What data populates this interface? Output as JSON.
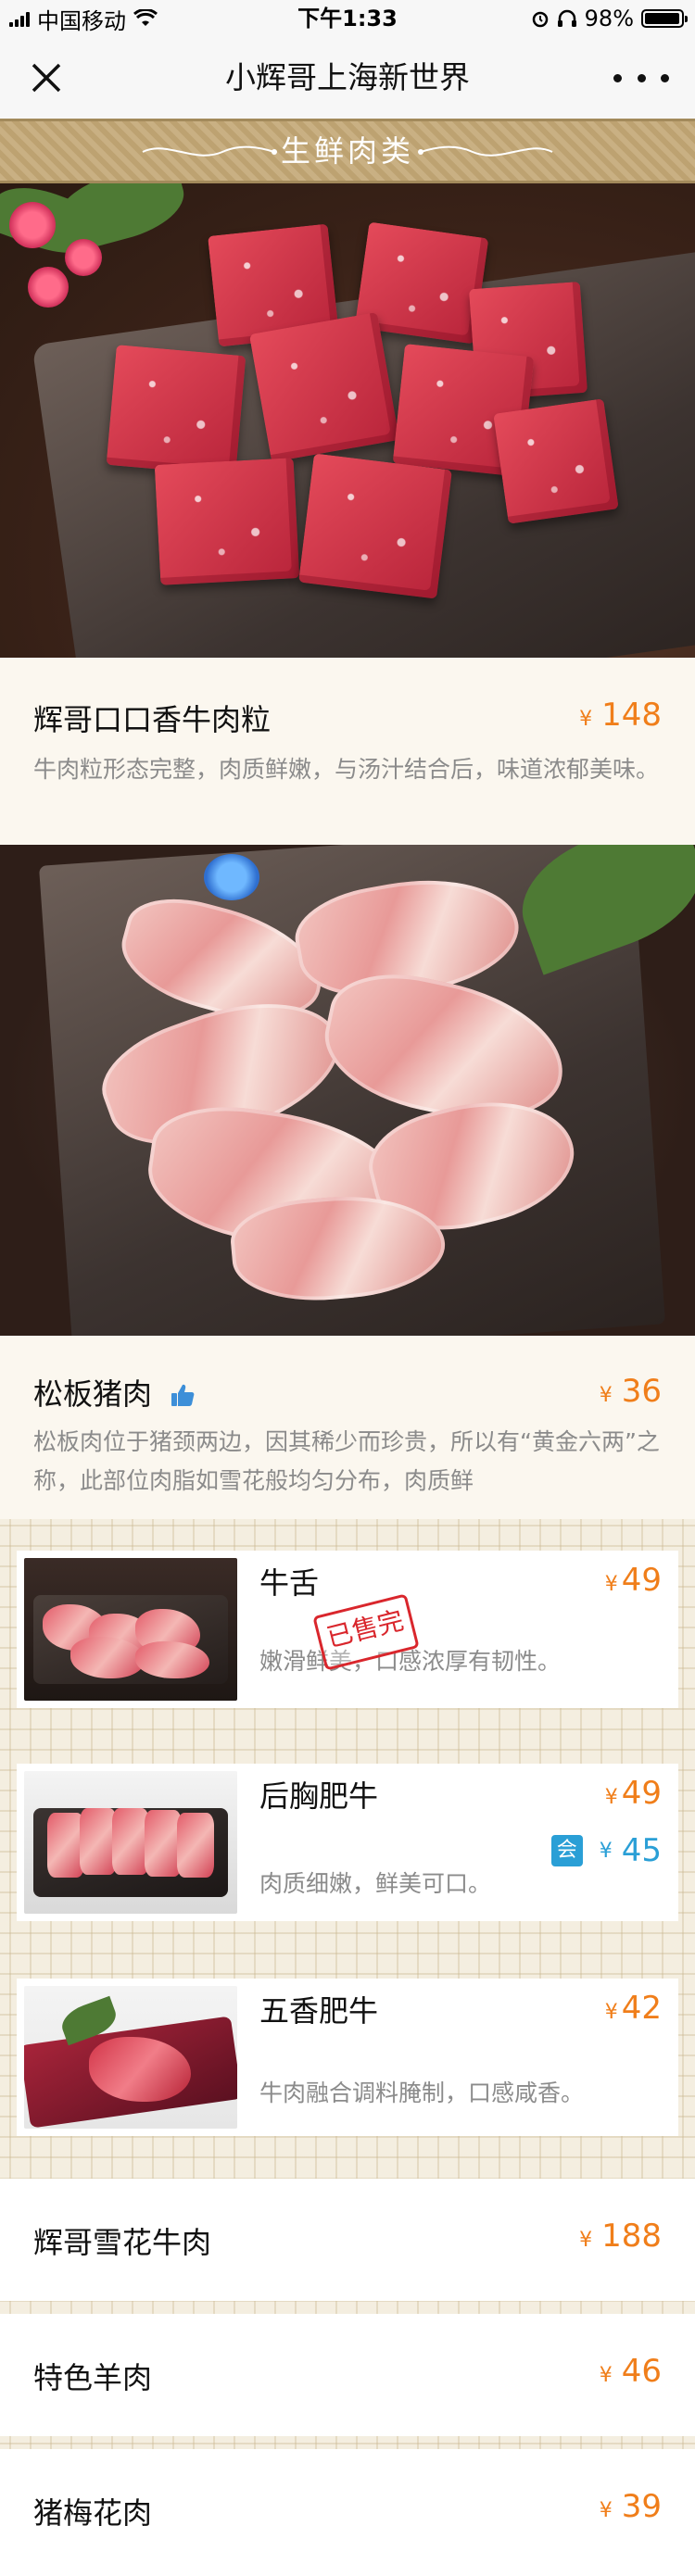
{
  "status_bar": {
    "carrier": "中国移动",
    "time": "下午1:33",
    "battery": "98%",
    "battery_level": 0.98
  },
  "nav": {
    "title": "小辉哥上海新世界"
  },
  "category": {
    "title": "生鲜肉类"
  },
  "featured": [
    {
      "name": "辉哥口口香牛肉粒",
      "currency": "¥",
      "price": "148",
      "desc": "牛肉粒形态完整，肉质鲜嫩，与汤汁结合后，味道浓郁美味。"
    },
    {
      "name": "松板猪肉",
      "currency": "¥",
      "price": "36",
      "desc": "松板肉位于猪颈两边，因其稀少而珍贵，所以有“黄金六两”之称，此部位肉脂如雪花般均匀分布，肉质鲜"
    }
  ],
  "cards": [
    {
      "name": "牛舌",
      "currency": "¥",
      "price": "49",
      "desc": "嫩滑鲜美，口感浓厚有韧性。",
      "stamp": "已售完"
    },
    {
      "name": "后胸肥牛",
      "currency": "¥",
      "price": "49",
      "member_badge": "会",
      "member_price": "45",
      "desc": "肉质细嫩，鲜美可口。"
    },
    {
      "name": "五香肥牛",
      "currency": "¥",
      "price": "42",
      "desc": "牛肉融合调料腌制，口感咸香。"
    }
  ],
  "list": [
    {
      "name": "辉哥雪花牛肉",
      "currency": "¥",
      "price": "188"
    },
    {
      "name": "特色羊肉",
      "currency": "¥",
      "price": "46"
    },
    {
      "name": "猪梅花肉",
      "currency": "¥",
      "price": "39"
    }
  ],
  "icons": {
    "close": "close-icon",
    "more": "more-icon",
    "thumb": "thumbs-up-icon",
    "wifi": "wifi-icon",
    "alarm": "alarm-icon",
    "headphones": "headphones-icon"
  },
  "colors": {
    "price": "#f07e1a",
    "member": "#2a9fd6",
    "banner": "#c9b083",
    "stamp": "#d9262c"
  }
}
